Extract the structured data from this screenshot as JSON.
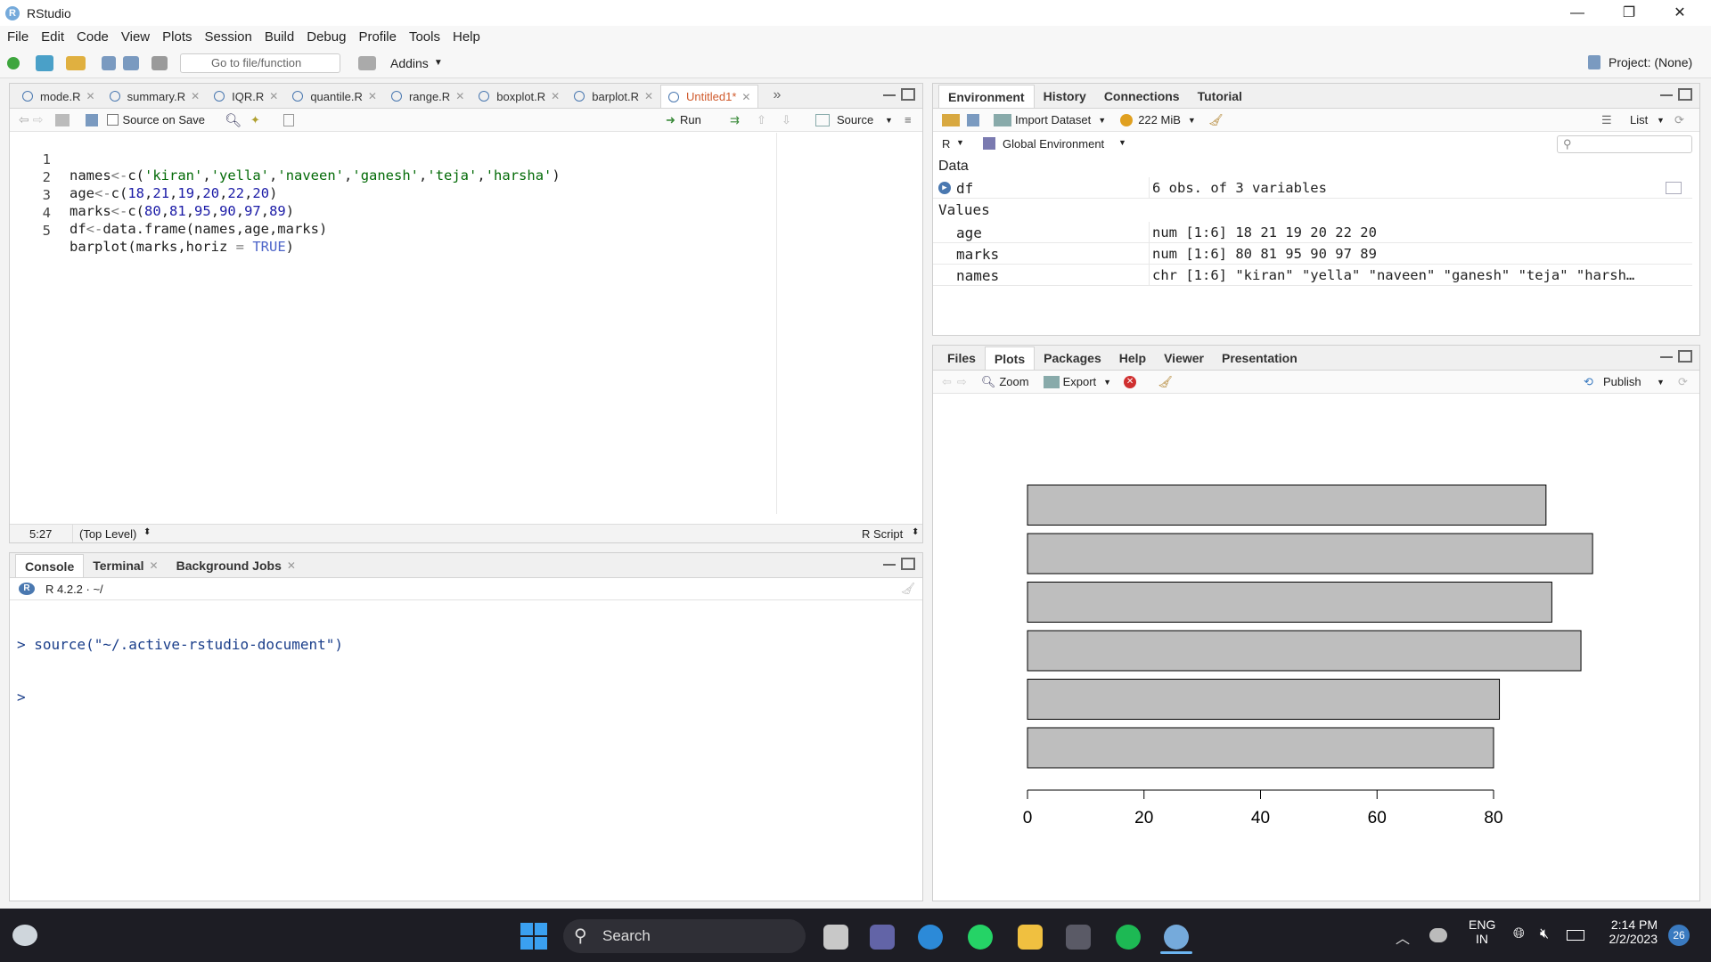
{
  "window": {
    "title": "RStudio",
    "minimize": "—",
    "maximize": "❐",
    "close": "✕"
  },
  "menu": [
    "File",
    "Edit",
    "Code",
    "View",
    "Plots",
    "Session",
    "Build",
    "Debug",
    "Profile",
    "Tools",
    "Help"
  ],
  "toolbar": {
    "goto_placeholder": "Go to file/function",
    "addins": "Addins",
    "project": "Project: (None)"
  },
  "editor": {
    "tabs": [
      "mode.R",
      "summary.R",
      "IQR.R",
      "quantile.R",
      "range.R",
      "boxplot.R",
      "barplot.R",
      "Untitled1*"
    ],
    "active_tab": "Untitled1*",
    "source_on_save": "Source on Save",
    "run": "Run",
    "source": "Source",
    "lines": [
      {
        "n": "1",
        "text": "names<-c('kiran','yella','naveen','ganesh','teja','harsha')"
      },
      {
        "n": "2",
        "text": "age<-c(18,21,19,20,22,20)"
      },
      {
        "n": "3",
        "text": "marks<-c(80,81,95,90,97,89)"
      },
      {
        "n": "4",
        "text": "df<-data.frame(names,age,marks)"
      },
      {
        "n": "5",
        "text": "barplot(marks,horiz = TRUE)"
      }
    ],
    "status_pos": "5:27",
    "status_scope": "(Top Level)",
    "status_type": "R Script"
  },
  "console": {
    "tabs": [
      "Console",
      "Terminal",
      "Background Jobs"
    ],
    "version": "R 4.2.2 · ~/",
    "lines": [
      "> source(\"~/.active-rstudio-document\")",
      ">"
    ]
  },
  "environment": {
    "tabs": [
      "Environment",
      "History",
      "Connections",
      "Tutorial"
    ],
    "import_dataset": "Import Dataset",
    "memory": "222 MiB",
    "view_mode": "List",
    "language": "R",
    "scope": "Global Environment",
    "section_data": "Data",
    "section_values": "Values",
    "data_rows": [
      {
        "name": "df",
        "value": "6 obs. of 3 variables"
      }
    ],
    "value_rows": [
      {
        "name": "age",
        "value": "num [1:6] 18 21 19 20 22 20"
      },
      {
        "name": "marks",
        "value": "num [1:6] 80 81 95 90 97 89"
      },
      {
        "name": "names",
        "value": "chr [1:6] \"kiran\" \"yella\" \"naveen\" \"ganesh\" \"teja\" \"harsh…"
      }
    ]
  },
  "files_pane": {
    "tabs": [
      "Files",
      "Plots",
      "Packages",
      "Help",
      "Viewer",
      "Presentation"
    ],
    "active_tab": "Plots",
    "zoom": "Zoom",
    "export": "Export",
    "publish": "Publish"
  },
  "chart_data": {
    "type": "bar",
    "orientation": "horizontal",
    "values": [
      80,
      81,
      95,
      90,
      97,
      89
    ],
    "xticks": [
      "0",
      "20",
      "40",
      "60",
      "80"
    ],
    "xlim": [
      0,
      97
    ],
    "bar_color": "#bebebe",
    "title": "",
    "xlabel": "",
    "ylabel": ""
  },
  "taskbar": {
    "search": "Search",
    "lang_line1": "ENG",
    "lang_line2": "IN",
    "time": "2:14 PM",
    "date": "2/2/2023",
    "badge": "26"
  }
}
